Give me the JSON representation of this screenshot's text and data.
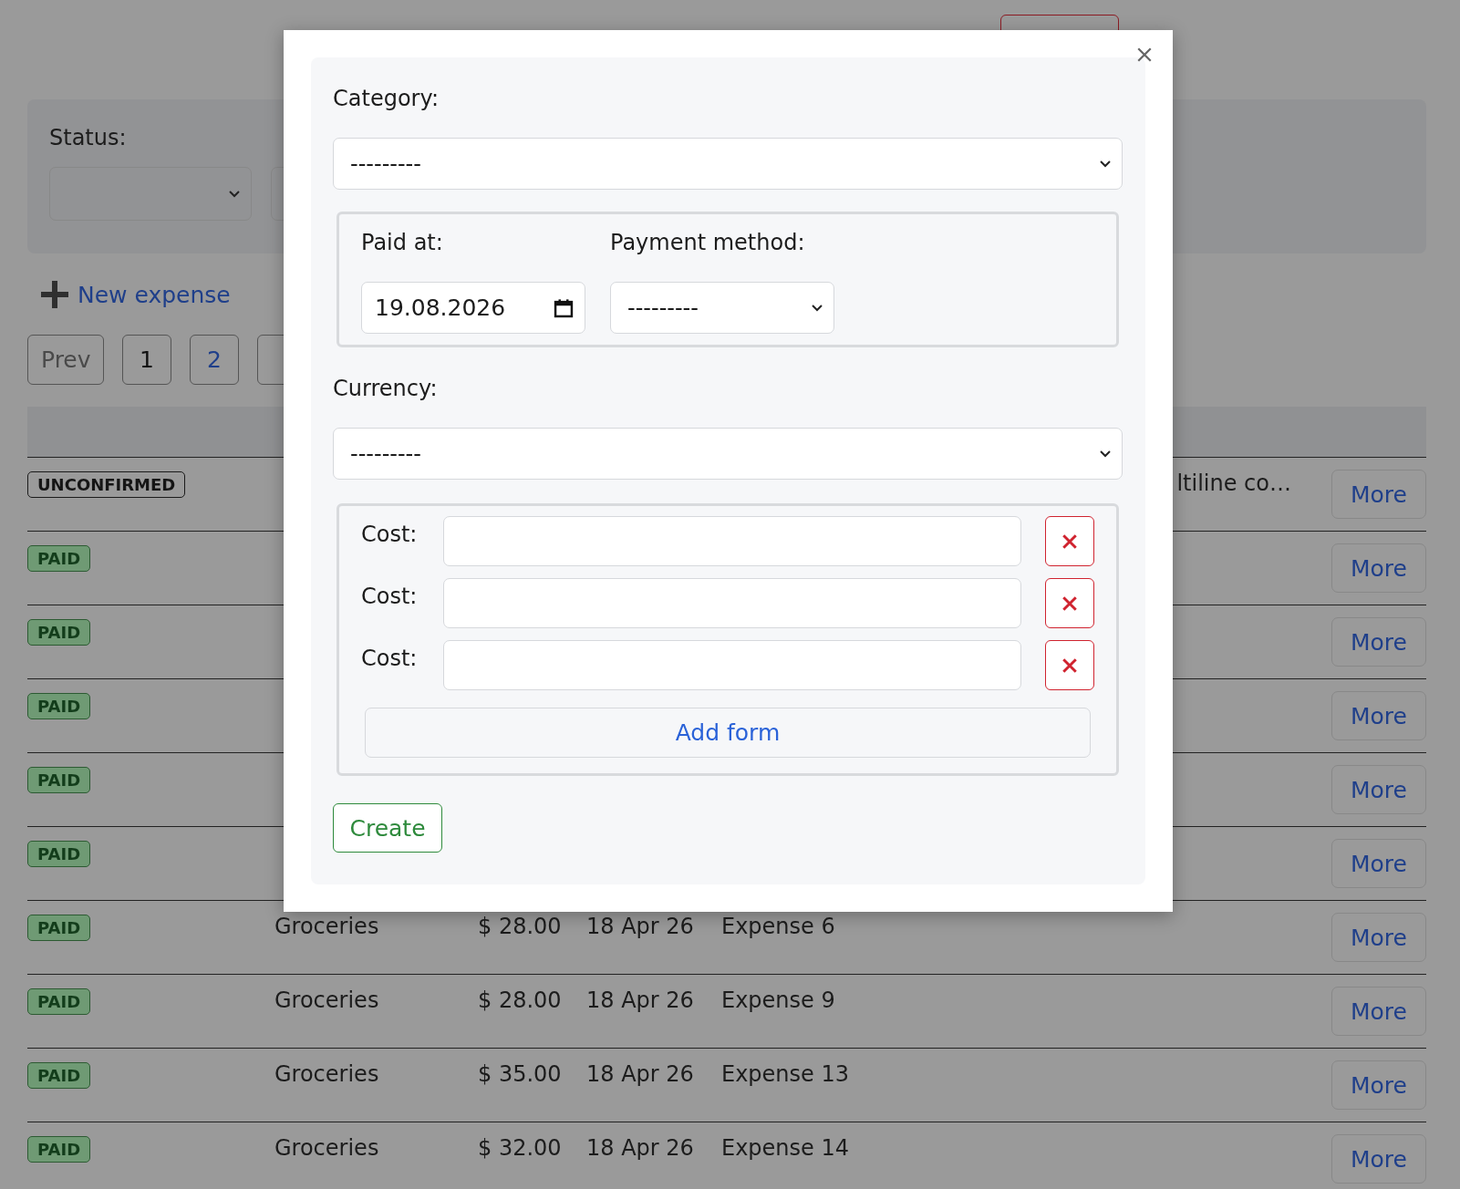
{
  "filters": [
    {
      "label": "Status:",
      "kind": "select"
    },
    {
      "kind": "field"
    }
  ],
  "actions": {
    "new_expense": "New expense"
  },
  "pagination": [
    {
      "label": "Prev",
      "kind": "nav",
      "selected": false
    },
    {
      "label": "1",
      "kind": "page",
      "selected": true
    },
    {
      "label": "2",
      "kind": "page",
      "selected": false
    },
    {
      "kind": "page"
    }
  ],
  "table": {
    "rows": [
      {
        "status": "UNCONFIRMED",
        "kind": "unconfirmed",
        "description": "ltiline co…",
        "action": "More"
      },
      {
        "status": "PAID",
        "kind": "paid",
        "action": "More"
      },
      {
        "status": "PAID",
        "kind": "paid",
        "action": "More"
      },
      {
        "status": "PAID",
        "kind": "paid",
        "action": "More"
      },
      {
        "status": "PAID",
        "kind": "paid",
        "action": "More"
      },
      {
        "status": "PAID",
        "kind": "paid",
        "action": "More"
      },
      {
        "status": "PAID",
        "kind": "paid",
        "category": "Groceries",
        "amount": "$ 28.00",
        "date": "18 Apr 26",
        "name": "Expense 6",
        "description": "",
        "action": "More"
      },
      {
        "status": "PAID",
        "kind": "paid",
        "category": "Groceries",
        "amount": "$ 28.00",
        "date": "18 Apr 26",
        "name": "Expense 9",
        "description": "",
        "action": "More"
      },
      {
        "status": "PAID",
        "kind": "paid",
        "category": "Groceries",
        "amount": "$ 35.00",
        "date": "18 Apr 26",
        "name": "Expense 13",
        "description": "",
        "action": "More"
      },
      {
        "status": "PAID",
        "kind": "paid",
        "category": "Groceries",
        "amount": "$ 32.00",
        "date": "18 Apr 26",
        "name": "Expense 14",
        "description": "",
        "action": "More"
      }
    ]
  },
  "modal": {
    "category": {
      "label": "Category:",
      "value": "---------"
    },
    "paid_at": {
      "label": "Paid at:",
      "value": "19.08.2026"
    },
    "payment_method": {
      "label": "Payment method:",
      "value": "---------"
    },
    "currency": {
      "label": "Currency:",
      "value": "---------"
    },
    "costs": [
      {
        "label": "Cost:"
      },
      {
        "label": "Cost:"
      },
      {
        "label": "Cost:"
      }
    ],
    "add_form": "Add form",
    "submit": "Create"
  }
}
